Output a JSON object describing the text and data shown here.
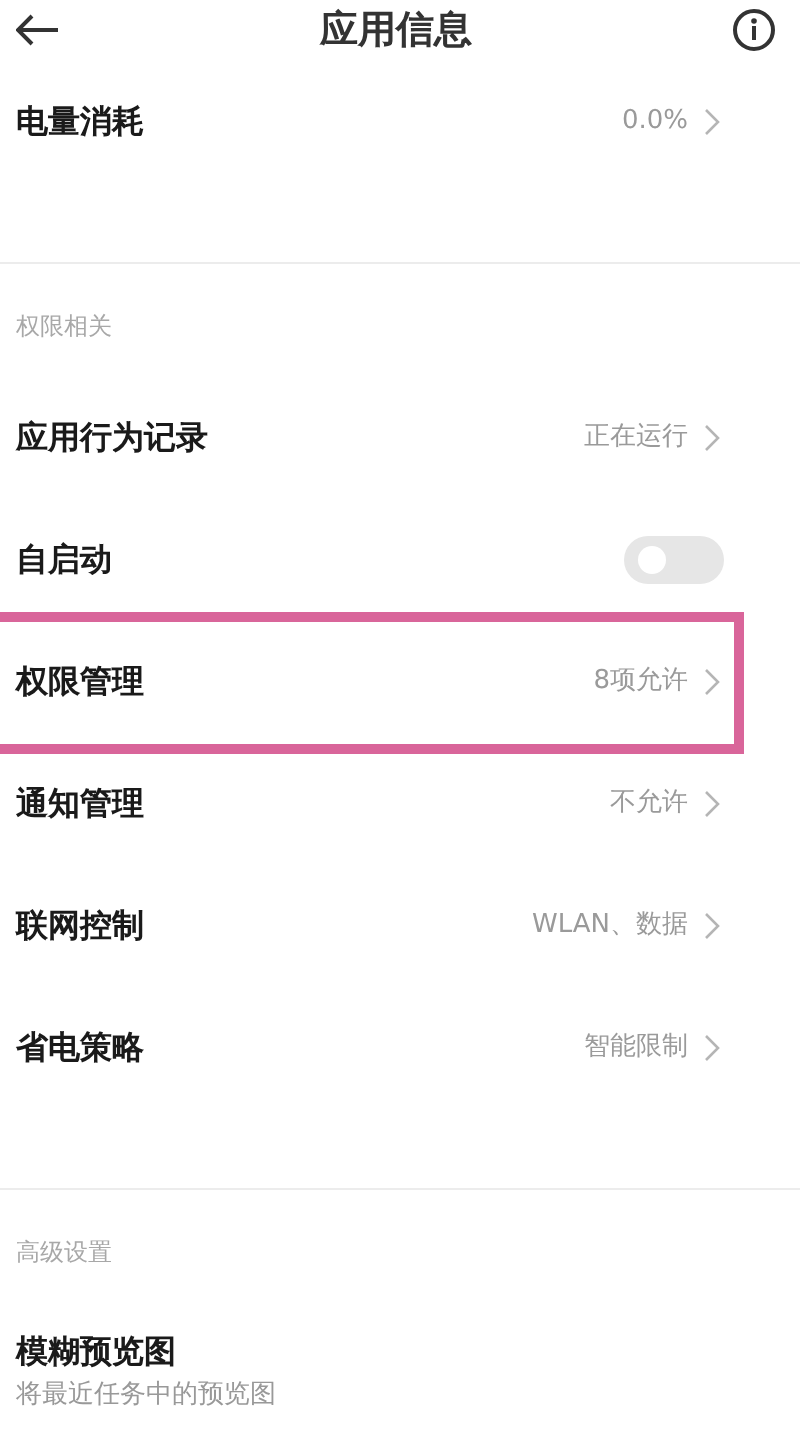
{
  "header": {
    "title": "应用信息"
  },
  "sections": [
    {
      "items": [
        {
          "kind": "value",
          "label": "电量消耗",
          "value": "0.0%"
        }
      ]
    },
    {
      "heading": "权限相关",
      "items": [
        {
          "kind": "value",
          "label": "应用行为记录",
          "value": "正在运行"
        },
        {
          "kind": "switch",
          "label": "自启动",
          "on": false
        },
        {
          "kind": "value",
          "label": "权限管理",
          "value": "8项允许",
          "highlighted": true
        },
        {
          "kind": "value",
          "label": "通知管理",
          "value": "不允许"
        },
        {
          "kind": "value",
          "label": "联网控制",
          "value": "WLAN、数据"
        },
        {
          "kind": "value",
          "label": "省电策略",
          "value": "智能限制"
        }
      ]
    },
    {
      "heading": "高级设置",
      "items": [
        {
          "kind": "subtitle",
          "label": "模糊预览图",
          "subtitle": "将最近任务中的预览图"
        }
      ]
    }
  ]
}
